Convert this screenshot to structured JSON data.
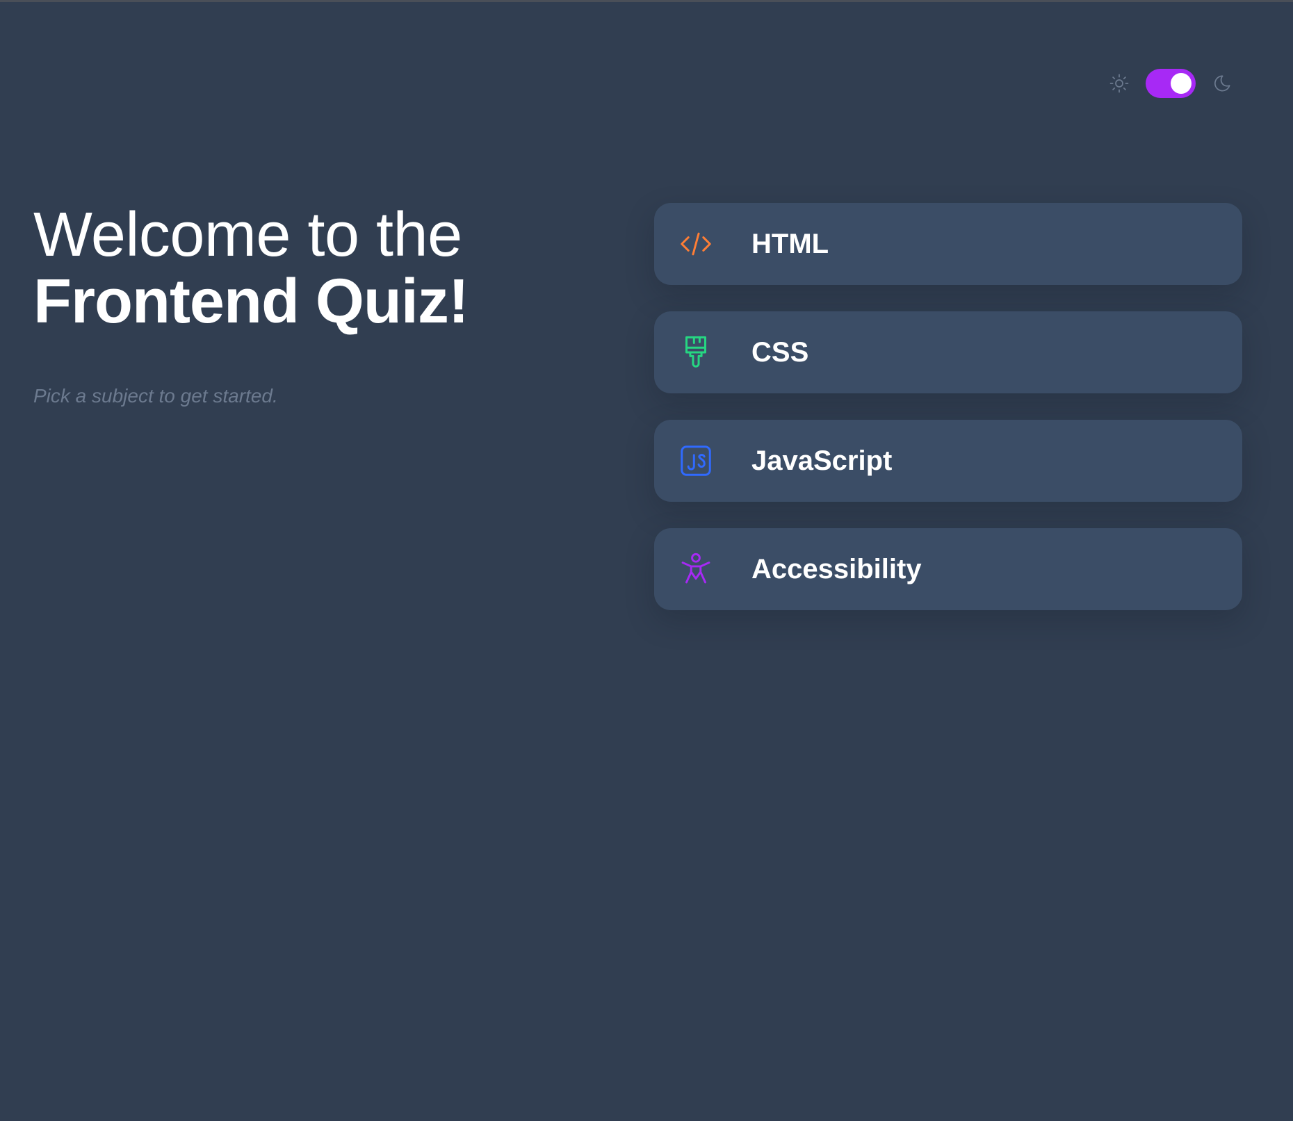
{
  "theme": {
    "light_icon": "sun-icon",
    "dark_icon": "moon-icon",
    "dark_mode_on": true,
    "accent_color": "#a729f5"
  },
  "hero": {
    "line1": "Welcome to the",
    "line2": "Frontend Quiz!",
    "subtitle": "Pick a subject to get started."
  },
  "subjects": [
    {
      "label": "HTML",
      "icon": "code-icon",
      "color": "#ff7e35"
    },
    {
      "label": "CSS",
      "icon": "paintbrush-icon",
      "color": "#26d782"
    },
    {
      "label": "JavaScript",
      "icon": "js-icon",
      "color": "#306aff"
    },
    {
      "label": "Accessibility",
      "icon": "accessibility-icon",
      "color": "#a729f5"
    }
  ],
  "colors": {
    "background": "#313e51",
    "card": "#3b4d66",
    "text": "#ffffff",
    "muted": "#6c7a8f"
  }
}
